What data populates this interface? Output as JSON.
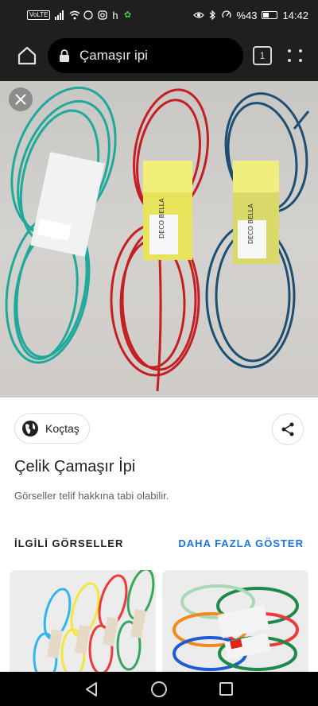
{
  "status_bar": {
    "volte": "VoLTE",
    "h_indicator": "h",
    "battery_percent": "%43",
    "battery_level": 0.43,
    "time": "14:42",
    "icons": [
      "signal-icon",
      "wifi-icon",
      "whatsapp-icon",
      "instagram-icon",
      "notification-icon",
      "eye-icon",
      "bluetooth-icon",
      "data-saver-icon",
      "battery-icon"
    ]
  },
  "browser": {
    "search_text": "Çamaşır ipi",
    "tab_count": "1",
    "icons": [
      "home-icon",
      "lock-icon",
      "tabs-icon",
      "more-vert-icon"
    ]
  },
  "image_viewer": {
    "close_icon": "close-icon",
    "product_colors": [
      "#1fa99a",
      "#c41f22",
      "#1d4f73"
    ],
    "label_text": "DECO BELLA"
  },
  "info": {
    "source": "Koçtaş",
    "title": "Çelik Çamaşır İpi",
    "copyright_notice": "Görseller telif hakkına tabi olabilir.",
    "related_heading": "İLGİLİ GÖRSELLER",
    "more_link": "DAHA FAZLA GÖSTER"
  },
  "navigation": {
    "icons": [
      "back-icon",
      "home-circle-icon",
      "recents-icon"
    ]
  }
}
